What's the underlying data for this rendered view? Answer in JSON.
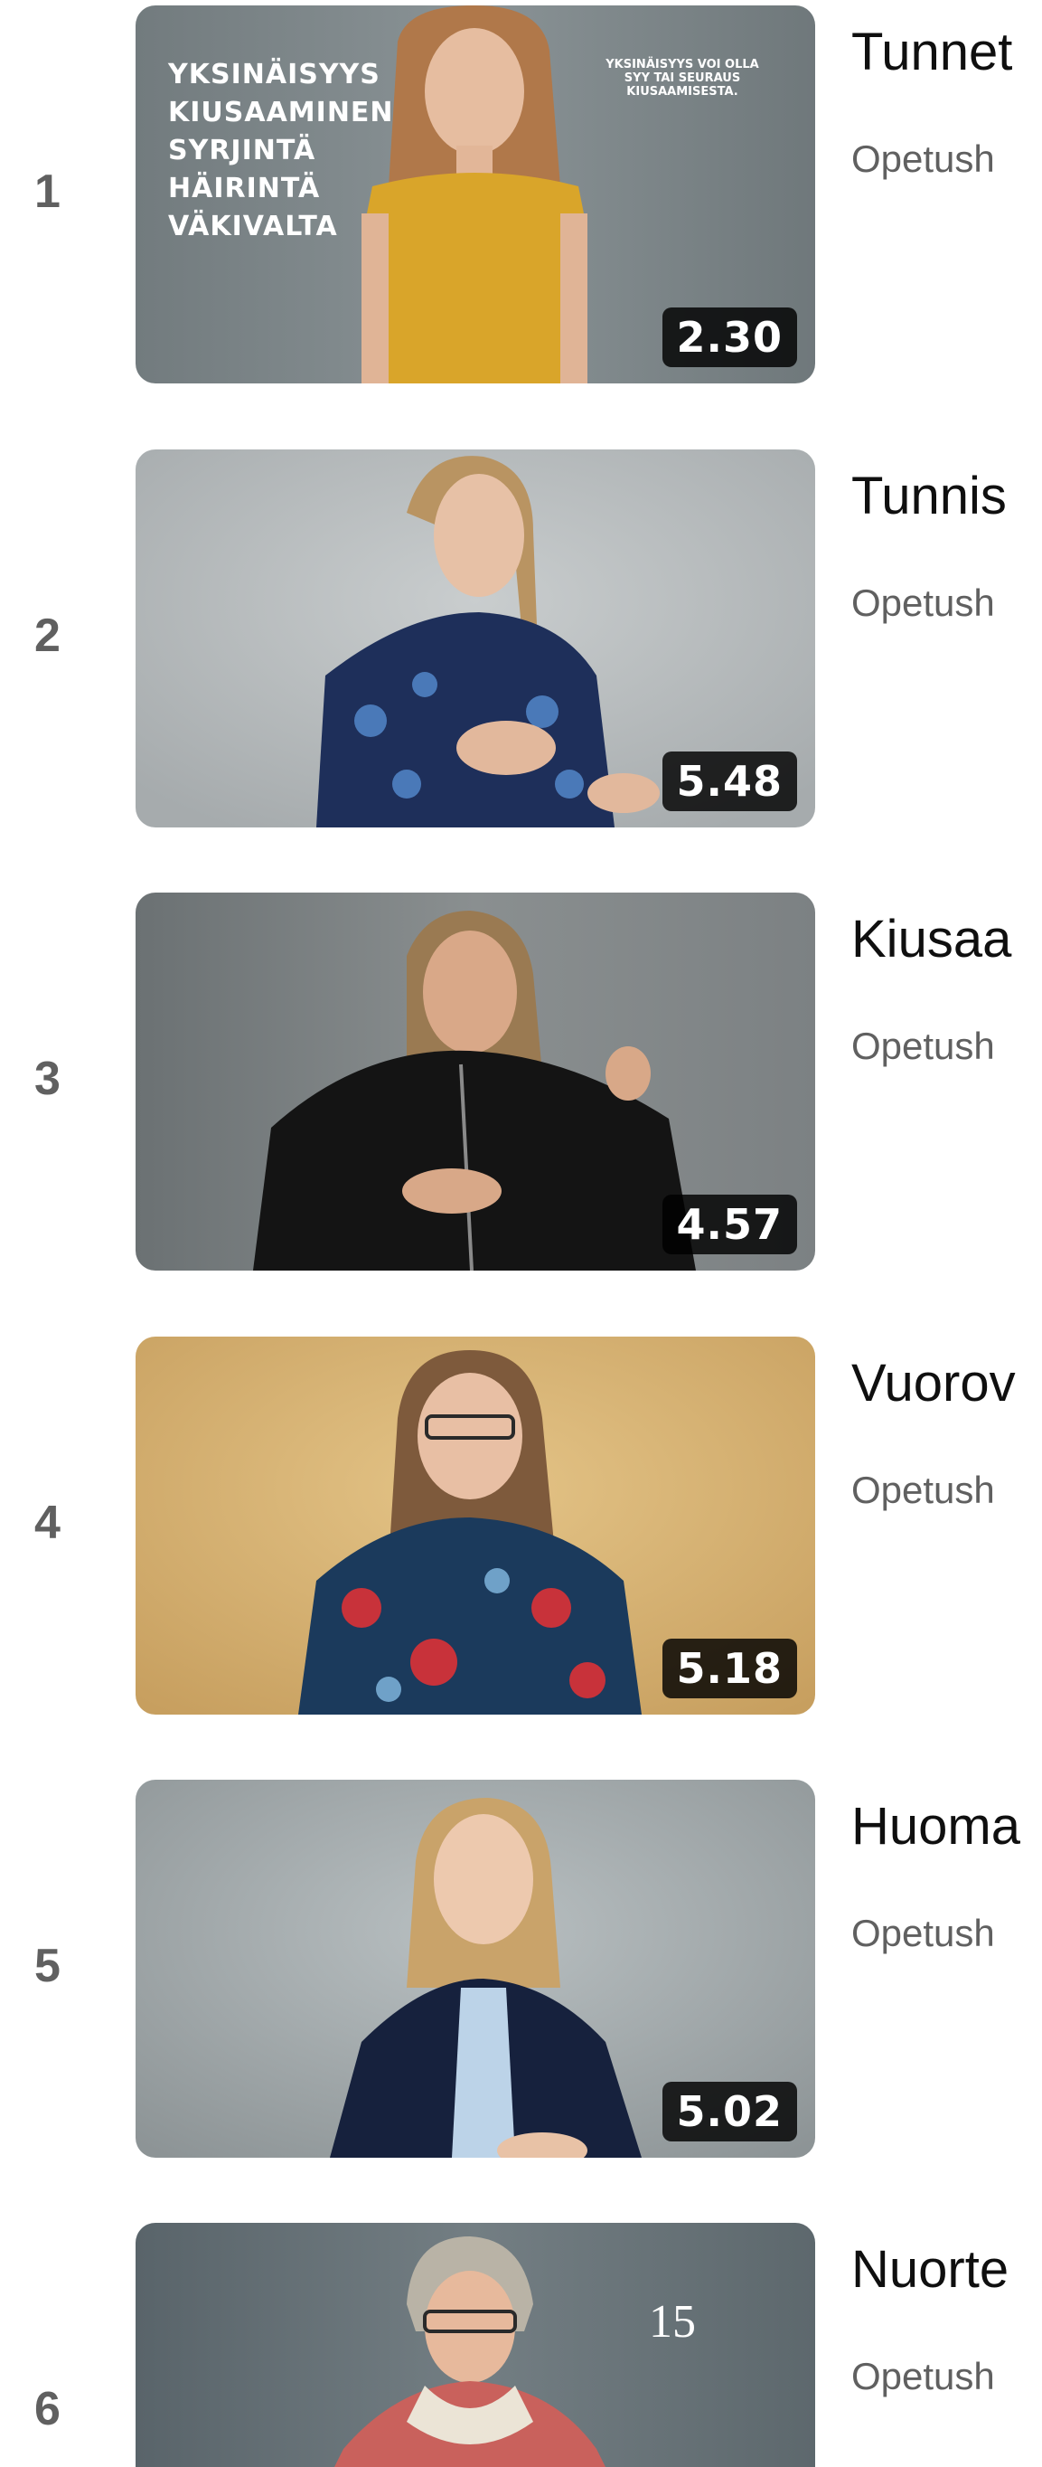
{
  "playlist": {
    "items": [
      {
        "index": "1",
        "title": "Tunnet",
        "channel": "Opetush",
        "duration": "2.30",
        "overlay_left": [
          "YKSINÄISYYS",
          "KIUSAAMINEN",
          "SYRJINTÄ",
          "HÄIRINTÄ",
          "VÄKIVALTA"
        ],
        "overlay_right": [
          "YKSINÄISYYS VOI OLLA",
          "SYY TAI SEURAUS",
          "KIUSAAMISESTA."
        ]
      },
      {
        "index": "2",
        "title": "Tunnis",
        "channel": "Opetush",
        "duration": "5.48"
      },
      {
        "index": "3",
        "title": "Kiusaa",
        "channel": "Opetush",
        "duration": "4.57"
      },
      {
        "index": "4",
        "title": "Vuorov",
        "channel": "Opetush",
        "duration": "5.18"
      },
      {
        "index": "5",
        "title": "Huoma",
        "channel": "Opetush",
        "duration": "5.02"
      },
      {
        "index": "6",
        "title": "Nuorte",
        "channel": "Opetush"
      }
    ]
  },
  "page_number": "15",
  "colors": {
    "text_primary": "#0f0f0f",
    "text_secondary": "#606060",
    "duration_badge": "#1c1c1c",
    "shirt_yellow": "#d9a52a",
    "background_beige": "#d8b472"
  }
}
